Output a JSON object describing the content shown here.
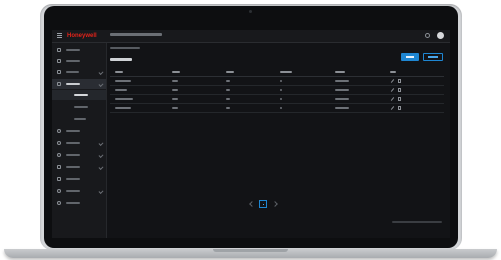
{
  "brand": {
    "logo_text": "Honeywell",
    "accent": "#1e86d2",
    "logo_color": "#e2231a"
  },
  "topbar": {
    "icons": [
      "menu-icon",
      "gear-icon",
      "user-avatar"
    ]
  },
  "sidebar": {
    "items": [
      {
        "icon": "home-icon",
        "state": "normal"
      },
      {
        "icon": "monitor-icon",
        "state": "normal"
      },
      {
        "icon": "data-icon",
        "state": "normal",
        "expandable": true
      },
      {
        "icon": "settings-icon",
        "state": "active",
        "expandable": true
      },
      {
        "icon": "",
        "state": "sub-active"
      },
      {
        "icon": "",
        "state": "sub"
      },
      {
        "icon": "",
        "state": "sub"
      },
      {
        "icon": "clock-icon",
        "state": "normal"
      },
      {
        "icon": "shield-icon",
        "state": "normal",
        "expandable": true
      },
      {
        "icon": "gear-icon",
        "state": "normal",
        "expandable": true
      },
      {
        "icon": "doc-icon",
        "state": "normal",
        "expandable": true
      },
      {
        "icon": "list-icon",
        "state": "normal"
      },
      {
        "icon": "user-icon",
        "state": "normal",
        "expandable": true
      },
      {
        "icon": "info-icon",
        "state": "normal"
      }
    ]
  },
  "table": {
    "row_count": 4,
    "actions": [
      "edit-icon",
      "delete-icon"
    ]
  },
  "pagination": {
    "current_page": 1
  }
}
